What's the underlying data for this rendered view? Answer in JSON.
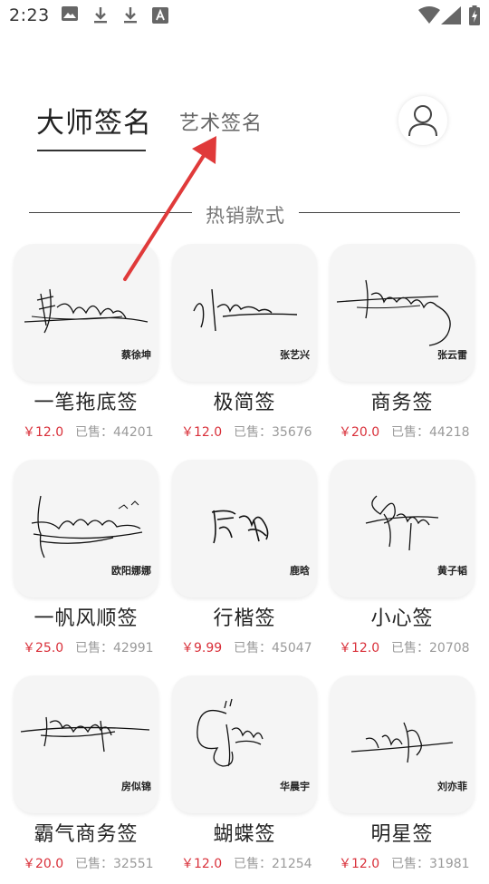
{
  "status_bar": {
    "time": "2:23"
  },
  "header": {
    "tab_master": "大师签名",
    "tab_art": "艺术签名"
  },
  "section": {
    "title": "热销款式"
  },
  "products": [
    {
      "title": "一笔拖底签",
      "signer": "蔡徐坤",
      "price": "￥12.0",
      "sold": "已售：44201"
    },
    {
      "title": "极简签",
      "signer": "张艺兴",
      "price": "￥12.0",
      "sold": "已售：35676"
    },
    {
      "title": "商务签",
      "signer": "张云雷",
      "price": "￥20.0",
      "sold": "已售：44218"
    },
    {
      "title": "一帆风顺签",
      "signer": "欧阳娜娜",
      "price": "￥25.0",
      "sold": "已售：42991"
    },
    {
      "title": "行楷签",
      "signer": "鹿晗",
      "price": "￥9.99",
      "sold": "已售：45047"
    },
    {
      "title": "小心签",
      "signer": "黄子韬",
      "price": "￥12.0",
      "sold": "已售：20708"
    },
    {
      "title": "霸气商务签",
      "signer": "房似锦",
      "price": "￥20.0",
      "sold": "已售：32551"
    },
    {
      "title": "蝴蝶签",
      "signer": "华晨宇",
      "price": "￥12.0",
      "sold": "已售：21254"
    },
    {
      "title": "明星签",
      "signer": "刘亦菲",
      "price": "￥12.0",
      "sold": "已售：31981"
    }
  ],
  "colors": {
    "price": "#d9303a",
    "annotation_arrow": "#e03a3a"
  }
}
